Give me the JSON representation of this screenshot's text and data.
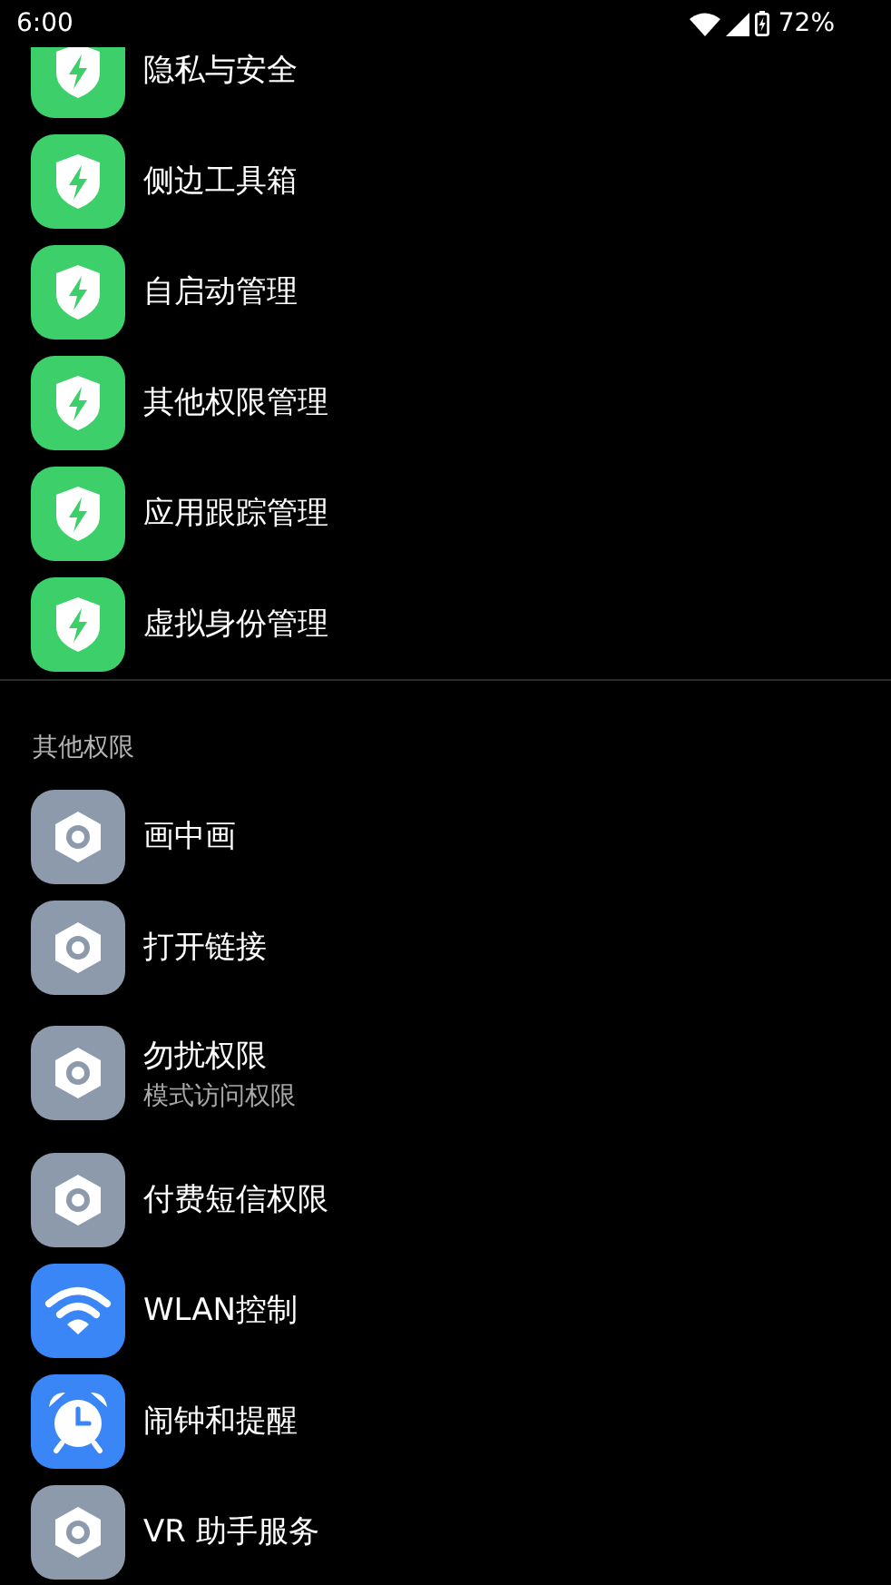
{
  "status_bar": {
    "time": "6:00",
    "battery": "72%"
  },
  "sections": [
    {
      "items": [
        {
          "kind": "shield",
          "label": "隐私与安全"
        },
        {
          "kind": "shield",
          "label": "侧边工具箱"
        },
        {
          "kind": "shield",
          "label": "自启动管理"
        },
        {
          "kind": "shield",
          "label": "其他权限管理"
        },
        {
          "kind": "shield",
          "label": "应用跟踪管理"
        },
        {
          "kind": "shield",
          "label": "虚拟身份管理"
        }
      ]
    },
    {
      "header": "其他权限",
      "items": [
        {
          "kind": "hex",
          "label": "画中画"
        },
        {
          "kind": "hex",
          "label": "打开链接"
        },
        {
          "kind": "hex",
          "label": "勿扰权限",
          "sublabel": "模式访问权限"
        },
        {
          "kind": "hex",
          "label": "付费短信权限"
        },
        {
          "kind": "wifi",
          "label": "WLAN控制"
        },
        {
          "kind": "alarm",
          "label": "闹钟和提醒"
        },
        {
          "kind": "hex",
          "label": "VR 助手服务"
        }
      ]
    }
  ]
}
